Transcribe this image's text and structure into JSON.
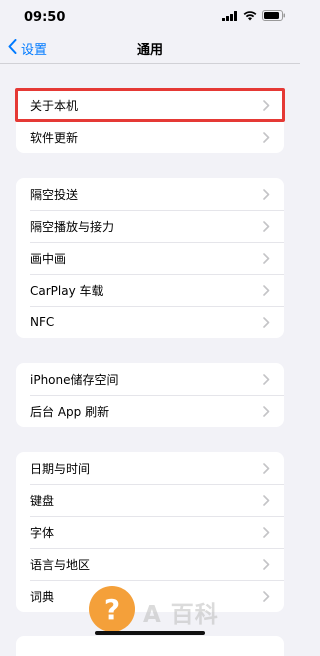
{
  "status_bar": {
    "time": "09:50"
  },
  "nav": {
    "back_label": "设置",
    "title": "通用"
  },
  "groups": [
    {
      "rows": [
        {
          "label": "关于本机"
        },
        {
          "label": "软件更新"
        }
      ]
    },
    {
      "rows": [
        {
          "label": "隔空投送"
        },
        {
          "label": "隔空播放与接力"
        },
        {
          "label": "画中画"
        },
        {
          "label": "CarPlay 车载"
        },
        {
          "label": "NFC"
        }
      ]
    },
    {
      "rows": [
        {
          "label": "iPhone储存空间"
        },
        {
          "label": "后台 App 刷新"
        }
      ]
    },
    {
      "rows": [
        {
          "label": "日期与时间"
        },
        {
          "label": "键盘"
        },
        {
          "label": "字体"
        },
        {
          "label": "语言与地区"
        },
        {
          "label": "词典"
        }
      ]
    }
  ],
  "overlay": {
    "badge_symbol": "?",
    "watermark_text": "A 百科"
  },
  "colors": {
    "accent": "#007aff",
    "highlight": "#e53935",
    "badge": "#f4a03a",
    "background": "#f2f2f7"
  }
}
